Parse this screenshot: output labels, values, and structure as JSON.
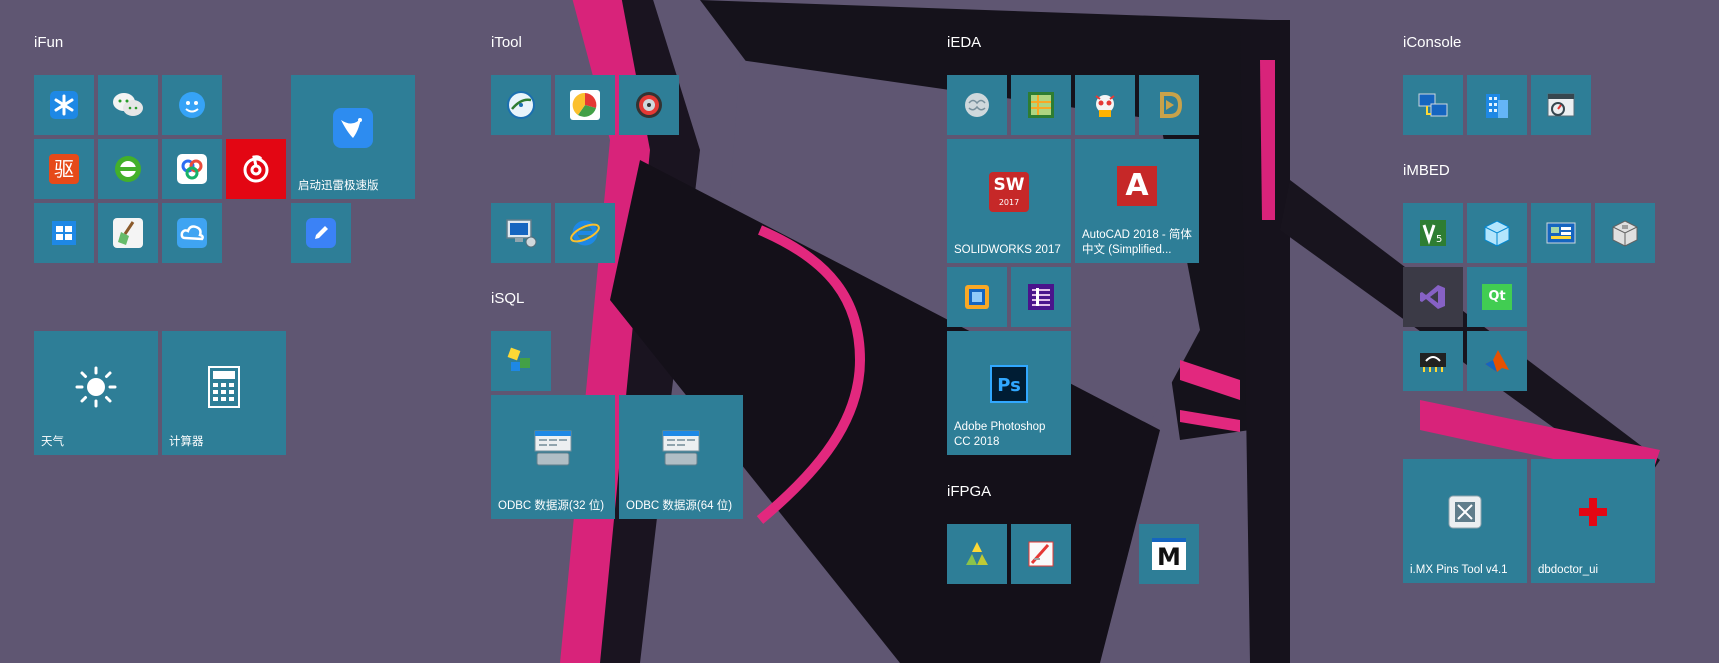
{
  "groups": {
    "ifun": "iFun",
    "itool": "iTool",
    "isql": "iSQL",
    "ieda": "iEDA",
    "ifpga": "iFPGA",
    "iconsole": "iConsole",
    "imbed": "iMBED"
  },
  "tiles": {
    "thunder": "启动迅雷极速版",
    "weather": "天气",
    "calculator": "计算器",
    "odbc32": "ODBC 数据源(32 位)",
    "odbc64": "ODBC 数据源(64 位)",
    "solidworks": "SOLIDWORKS 2017",
    "autocad": "AutoCAD 2018 - 简体中文 (Simplified...",
    "photoshop": "Adobe Photoshop CC 2018",
    "imx_pins": "i.MX Pins Tool v4.1",
    "dbdoctor": "dbdoctor_ui"
  },
  "icon_glyphs": {
    "driver": "驱",
    "ps": "Ps",
    "sw": "SW",
    "sw_year": "2017",
    "autocad": "A",
    "vs_s": "S",
    "qt": "Qt",
    "m": "M"
  },
  "colors": {
    "tile": "#2e7e97",
    "tile_red": "#e30613",
    "background": "#5f5672",
    "frame_pink": "#e2287e"
  }
}
